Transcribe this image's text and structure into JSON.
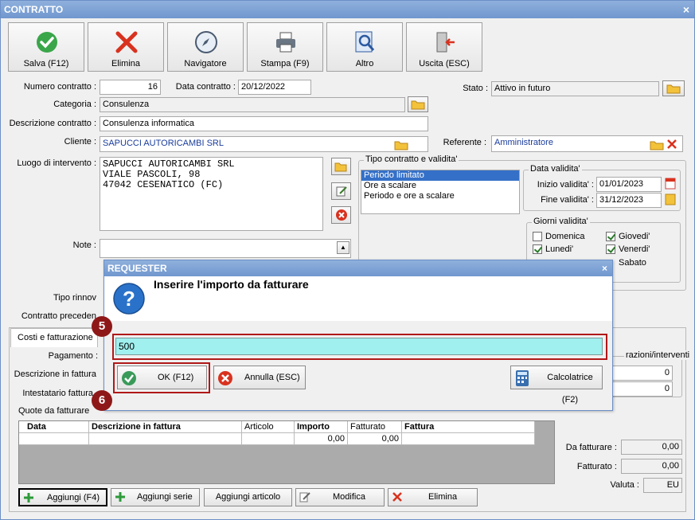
{
  "window": {
    "title": "CONTRATTO",
    "close": "×"
  },
  "toolbar": [
    {
      "label": "Salva (F12)",
      "icon": "check-circle-icon"
    },
    {
      "label": "Elimina",
      "icon": "red-x-icon"
    },
    {
      "label": "Navigatore",
      "icon": "compass-icon"
    },
    {
      "label": "Stampa (F9)",
      "icon": "printer-icon"
    },
    {
      "label": "Altro",
      "icon": "magnifier-icon"
    },
    {
      "label": "Uscita (ESC)",
      "icon": "exit-door-icon"
    }
  ],
  "form": {
    "numero_label": "Numero contratto :",
    "numero_value": "16",
    "data_label": "Data contratto :",
    "data_value": "20/12/2022",
    "stato_label": "Stato :",
    "stato_value": "Attivo in futuro",
    "categoria_label": "Categoria :",
    "categoria_value": "Consulenza",
    "descrizione_label": "Descrizione contratto :",
    "descrizione_value": "Consulenza informatica",
    "cliente_label": "Cliente :",
    "cliente_value": "SAPUCCI AUTORICAMBI SRL",
    "referente_label": "Referente :",
    "referente_value": "Amministratore",
    "luogo_label": "Luogo di intervento :",
    "luogo_value": "SAPUCCI AUTORICAMBI SRL\nVIALE PASCOLI, 98\n47042 CESENATICO (FC)",
    "note_label": "Note :",
    "tipo_rinnovo_label": "Tipo rinnov",
    "contratto_prec_label": "Contratto preceden"
  },
  "tipo_contratto": {
    "title": "Tipo contratto e validita'",
    "options": [
      "Periodo limitato",
      "Ore a scalare",
      "Periodo e ore a scalare"
    ],
    "selected": "Periodo limitato"
  },
  "data_validita": {
    "title": "Data validita'",
    "inizio_label": "Inizio validita' :",
    "inizio_value": "01/01/2023",
    "fine_label": "Fine validita' :",
    "fine_value": "31/12/2023"
  },
  "giorni": {
    "title": "Giorni validita'",
    "domenica": "Domenica",
    "lunedi": "Lunedi'",
    "giovedi": "Giovedi'",
    "venerdi": "Venerdi'",
    "sabato": "Sabato"
  },
  "costi": {
    "tab_label": "Costi e fatturazione",
    "pagamento_label": "Pagamento :",
    "descr_fattura_label": "Descrizione in fattura",
    "intestatario_label": "Intestatario fattura",
    "quote_label": "Quote da fatturare",
    "right_group_title": "razioni/interventi",
    "right_value_1": "0",
    "right_value_2": "0"
  },
  "quote_table": {
    "headers": [
      "Data",
      "Descrizione in fattura",
      "Articolo",
      "Importo",
      "Fatturato",
      "Fattura"
    ],
    "row": [
      "",
      "",
      "",
      "0,00",
      "0,00",
      ""
    ]
  },
  "totals": {
    "da_fatturare_label": "Da fatturare :",
    "da_fatturare_value": "0,00",
    "fatturato_label": "Fatturato :",
    "fatturato_value": "0,00",
    "valuta_label": "Valuta :",
    "valuta_value": "EU"
  },
  "bottom_buttons": {
    "aggiungi": "Aggiungi (F4)",
    "aggiungi_serie": "Aggiungi serie",
    "aggiungi_articolo": "Aggiungi articolo",
    "modifica": "Modifica",
    "elimina": "Elimina"
  },
  "dialog": {
    "title": "REQUESTER",
    "close": "×",
    "message": "Inserire l'importo da fatturare",
    "input_value": "500",
    "ok_label": "OK (F12)",
    "annulla_label": "Annulla (ESC)",
    "calcolatrice_label": "Calcolatrice (F2)"
  },
  "annotations": {
    "step5": "5",
    "step6": "6"
  }
}
